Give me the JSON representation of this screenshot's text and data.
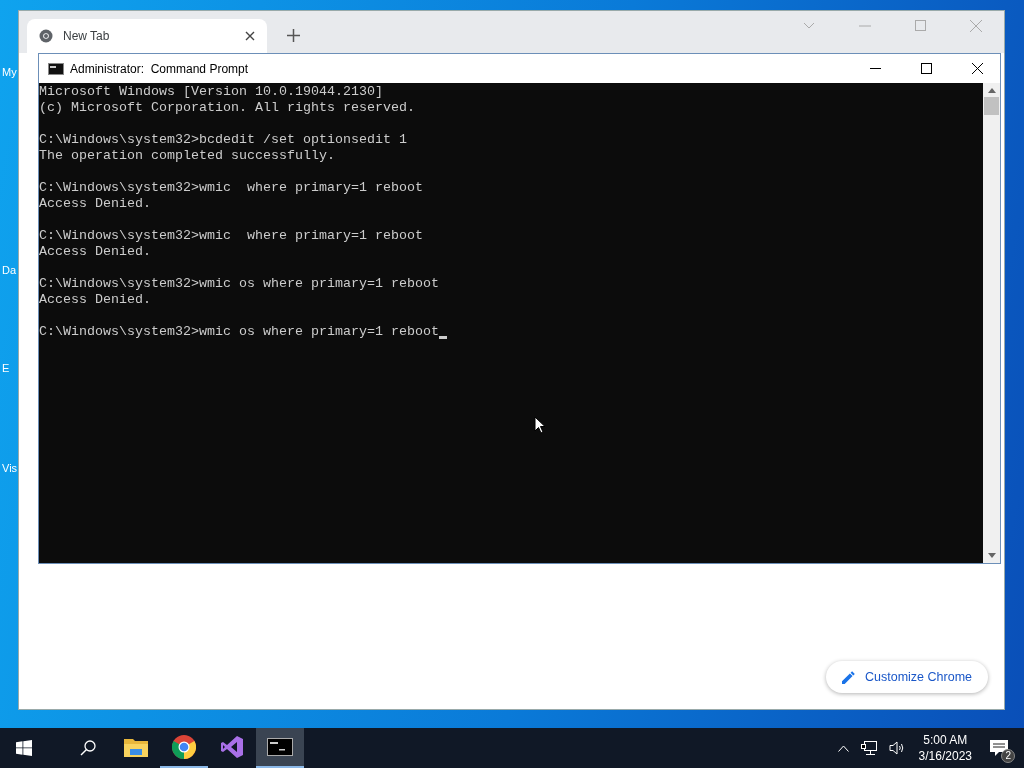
{
  "desktop_icons": [
    {
      "label": "My"
    },
    {
      "label": "Da"
    },
    {
      "label": "E"
    },
    {
      "label": "Vis"
    }
  ],
  "browser": {
    "tabs": [
      {
        "label": "New Tab",
        "selected": true
      }
    ],
    "customize_button": "Customize Chrome"
  },
  "console": {
    "title": "Administrator:  Command Prompt",
    "cursor": true,
    "blocks": [
      [
        "Microsoft Windows [Version 10.0.19044.2130]",
        "(c) Microsoft Corporation. All rights reserved."
      ],
      [
        "C:\\Windows\\system32>bcdedit /set optionsedit 1",
        "The operation completed successfully."
      ],
      [
        "C:\\Windows\\system32>wmic  where primary=1 reboot",
        "Access Denied."
      ],
      [
        "C:\\Windows\\system32>wmic  where primary=1 reboot",
        "Access Denied."
      ],
      [
        "C:\\Windows\\system32>wmic os where primary=1 reboot",
        "Access Denied."
      ],
      [
        "C:\\Windows\\system32>wmic os where primary=1 reboot"
      ]
    ]
  },
  "taskbar": {
    "apps": [
      {
        "kind": "folder",
        "running": false,
        "active": false
      },
      {
        "kind": "chrome",
        "running": true,
        "active": false
      },
      {
        "kind": "studio",
        "running": false,
        "active": false
      },
      {
        "kind": "console",
        "running": true,
        "active": true
      }
    ],
    "time": "5:00 AM",
    "date": "3/16/2023",
    "notifications": "2"
  }
}
